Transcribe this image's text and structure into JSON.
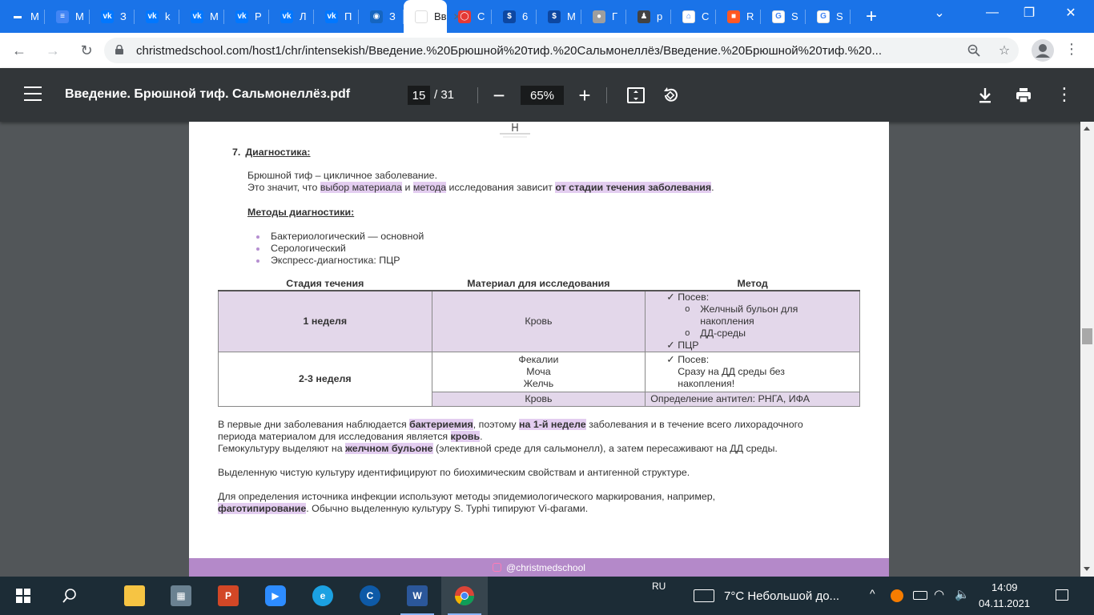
{
  "browser": {
    "tabs": [
      {
        "label": "М",
        "icon": "chat-icon",
        "color": "#1a73e8",
        "glyph": "▬"
      },
      {
        "label": "М",
        "icon": "docs-icon",
        "color": "#4285f4",
        "glyph": "≡"
      },
      {
        "label": "З",
        "icon": "vk-icon",
        "color": "#0077ff",
        "glyph": "vk"
      },
      {
        "label": "k",
        "icon": "vk-icon",
        "color": "#0077ff",
        "glyph": "vk"
      },
      {
        "label": "М",
        "icon": "vk-icon",
        "color": "#0077ff",
        "glyph": "vk"
      },
      {
        "label": "Р",
        "icon": "vk-icon",
        "color": "#0077ff",
        "glyph": "vk"
      },
      {
        "label": "Л",
        "icon": "vk-icon",
        "color": "#0077ff",
        "glyph": "vk"
      },
      {
        "label": "П",
        "icon": "vk-icon",
        "color": "#0077ff",
        "glyph": "vk"
      },
      {
        "label": "З",
        "icon": "eye-icon",
        "color": "#1565c0",
        "glyph": "◉"
      },
      {
        "label": "Вв",
        "icon": "page-icon",
        "color": "#ffffff",
        "glyph": ""
      },
      {
        "label": "С",
        "icon": "ring-icon",
        "color": "#e53935",
        "glyph": "◯"
      },
      {
        "label": "6",
        "icon": "dollar-icon",
        "color": "#0d47a1",
        "glyph": "$"
      },
      {
        "label": "М",
        "icon": "dollar-icon",
        "color": "#0d47a1",
        "glyph": "$"
      },
      {
        "label": "Г",
        "icon": "seal-icon",
        "color": "#9e9e9e",
        "glyph": "●"
      },
      {
        "label": "р",
        "icon": "person-icon",
        "color": "#424242",
        "glyph": "♟"
      },
      {
        "label": "С",
        "icon": "bank-icon",
        "color": "#ffffff",
        "glyph": "⌂"
      },
      {
        "label": "R",
        "icon": "grid-icon",
        "color": "#ff5722",
        "glyph": "■"
      },
      {
        "label": "S",
        "icon": "google-icon",
        "color": "#ffffff",
        "glyph": "G"
      },
      {
        "label": "S",
        "icon": "google-icon",
        "color": "#ffffff",
        "glyph": "G"
      }
    ],
    "url": "christmedschool.com/host1/chr/intensekish/Введение.%20Брюшной%20тиф.%20Сальмонеллёз/Введение.%20Брюшной%20тиф.%20..."
  },
  "pdf_toolbar": {
    "title": "Введение. Брюшной тиф. Сальмонеллёз.pdf",
    "page_current": "15",
    "page_total": "/ 31",
    "zoom": "65%"
  },
  "document": {
    "section_number": "7.",
    "section_title": "Диагностика:",
    "intro_line1": "Брюшной тиф – цикличное заболевание.",
    "intro_line2_a": "Это значит, что ",
    "intro_line2_hl1": "выбор материала",
    "intro_line2_b": " и ",
    "intro_line2_hl2": "метода",
    "intro_line2_c": " исследования зависит ",
    "intro_line2_hl3": "от стадии течения заболевания",
    "intro_line2_d": ".",
    "methods_heading": "Методы диагностики:",
    "methods": [
      "Бактериологический — основной",
      "Серологический",
      "Экспресс-диагностика: ПЦР"
    ],
    "table": {
      "headers": [
        "Стадия течения",
        "Материал для исследования",
        "Метод"
      ],
      "row1": {
        "stage": "1 неделя",
        "material": "Кровь",
        "m_posev": "Посев:",
        "m_sub1a": "Желчный бульон для",
        "m_sub1b": "накопления",
        "m_sub2": "ДД-среды",
        "m_pcr": "ПЦР"
      },
      "row2": {
        "stage": "2-3 неделя",
        "mat1": "Фекалии",
        "mat2": "Моча",
        "mat3": "Желчь",
        "m_posev": "Посев:",
        "m_l2": "Сразу на ДД среды без",
        "m_l3": "накопления!"
      },
      "row3": {
        "material": "Кровь",
        "method": "Определение антител: РНГА, ИФА"
      },
      "check_glyph": "✓",
      "circle_glyph": "o"
    },
    "para1_a": "В первые дни заболевания наблюдается ",
    "para1_hl1": "бактериемия",
    "para1_b": ", поэтому ",
    "para1_hl2": "на 1-й неделе",
    "para1_c": " заболевания и в течение всего лихорадочного",
    "para1_d": "периода материалом для исследования является ",
    "para1_hl3": "кровь",
    "para1_e": ".",
    "para2_a": "Гемокультуру выделяют на ",
    "para2_hl": "желчном бульоне",
    "para2_b": " (элективной среде для сальмонелл), а затем пересаживают на ДД среды.",
    "para3": "Выделенную чистую культуру идентифицируют по биохимическим свойствам и антигенной структуре.",
    "para4_a": "Для определения источника инфекции используют методы эпидемиологического маркирования, например,",
    "para4_hl": "фаготипирование",
    "para4_b": ". Обычно выделенную культуру S. Typhi типируют Vi-фагами.",
    "footer": "@christmedschool"
  },
  "taskbar": {
    "lang": "RU",
    "weather": "7°C  Небольшой до...",
    "time": "14:09",
    "date": "04.11.2021"
  }
}
